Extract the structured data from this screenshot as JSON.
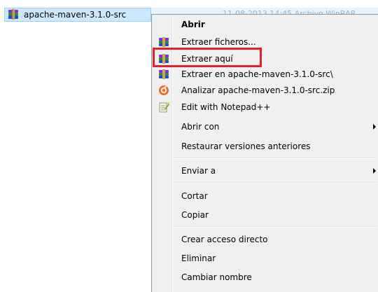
{
  "file": {
    "name": "apache-maven-3.1.0-src",
    "icon": "winrar-archive-icon",
    "detail_text": "11-08-2013 14:45   Archivo WinRAR"
  },
  "menu": {
    "items": [
      {
        "label": "Abrir",
        "bold": true,
        "icon": null,
        "submenu": false
      },
      {
        "label": "Extraer ficheros...",
        "icon": "winrar-icon",
        "submenu": false
      },
      {
        "label": "Extraer aquí",
        "icon": "winrar-icon",
        "submenu": false,
        "highlighted": true
      },
      {
        "label": "Extraer en apache-maven-3.1.0-src\\",
        "icon": "winrar-icon",
        "submenu": false
      },
      {
        "label": "Analizar apache-maven-3.1.0-src.zip",
        "icon": "avast-icon",
        "submenu": false
      },
      {
        "label": "Edit with Notepad++",
        "icon": "notepad-plus-plus-icon",
        "submenu": false
      },
      {
        "label": "Abrir con",
        "icon": null,
        "submenu": true
      },
      {
        "label": "Restaurar versiones anteriores",
        "icon": null,
        "submenu": false
      },
      {
        "label": "Enviar a",
        "icon": null,
        "submenu": true
      },
      {
        "label": "Cortar",
        "icon": null,
        "submenu": false
      },
      {
        "label": "Copiar",
        "icon": null,
        "submenu": false
      },
      {
        "label": "Crear acceso directo",
        "icon": null,
        "submenu": false
      },
      {
        "label": "Eliminar",
        "icon": null,
        "submenu": false
      },
      {
        "label": "Cambiar nombre",
        "icon": null,
        "submenu": false
      }
    ]
  },
  "colors": {
    "selection_fill": "#cce8ff",
    "menu_background": "#f0f0f0",
    "highlight_border": "#e3202b"
  }
}
